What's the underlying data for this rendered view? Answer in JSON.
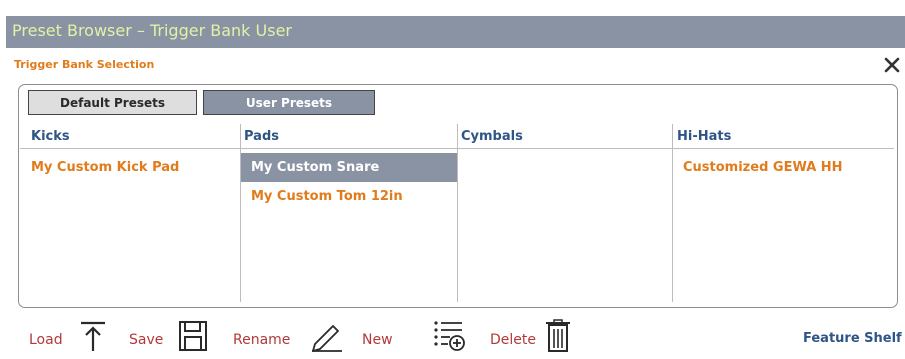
{
  "window": {
    "title": "Preset Browser – Trigger Bank User"
  },
  "section": {
    "label": "Trigger Bank Selection"
  },
  "tabs": [
    {
      "label": "Default Presets",
      "active": false
    },
    {
      "label": "User Presets",
      "active": true
    }
  ],
  "columns": [
    {
      "header": "Kicks",
      "items": [
        "My Custom Kick Pad"
      ]
    },
    {
      "header": "Pads",
      "items": [
        "My Custom Snare",
        "My Custom Tom 12in"
      ],
      "selected": "My Custom Snare"
    },
    {
      "header": "Cymbals",
      "items": []
    },
    {
      "header": "Hi-Hats",
      "items": [
        "Customized GEWA HH"
      ]
    }
  ],
  "toolbar": {
    "load_label": "Load",
    "save_label": "Save",
    "rename_label": "Rename",
    "new_label": "New",
    "delete_label": "Delete",
    "feature_shelf_label": "Feature Shelf",
    "icons": [
      "upload-icon",
      "save-icon",
      "pencil-icon",
      "add-list-icon",
      "trash-icon"
    ]
  },
  "colors": {
    "titlebar": "#8a93a4",
    "title_text": "#e2f2a6",
    "accent_orange": "#e07c1c",
    "header_blue": "#2f5587",
    "toolbar_red": "#b03a3a",
    "selected_row": "#8a93a4"
  }
}
